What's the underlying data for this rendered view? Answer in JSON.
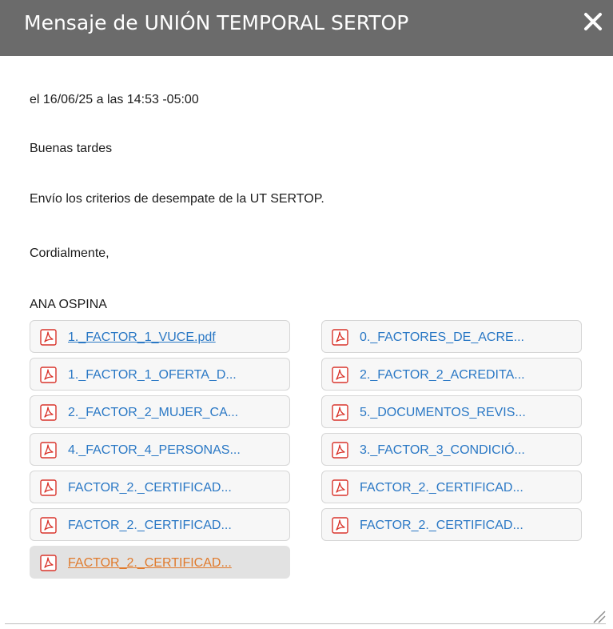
{
  "dialog": {
    "title": "Mensaje de UNIÓN TEMPORAL SERTOP",
    "close_icon": "close-icon",
    "header_color": "#6b6b6b"
  },
  "message": {
    "date_line": "el 16/06/25 a las 14:53 -05:00",
    "greeting": "Buenas tardes",
    "body": "Envío los criterios de desempate de la UT SERTOP.",
    "closing": "Cordialmente,",
    "signature": "ANA OSPINA"
  },
  "attachments": [
    {
      "name": "1._FACTOR_1_VUCE.pdf",
      "icon": "pdf-icon"
    },
    {
      "name": "0._FACTORES_DE_ACRE...",
      "icon": "pdf-icon"
    },
    {
      "name": "1._FACTOR_1_OFERTA_D...",
      "icon": "pdf-icon"
    },
    {
      "name": "2._FACTOR_2_ACREDITA...",
      "icon": "pdf-icon"
    },
    {
      "name": "2._FACTOR_2_MUJER_CA...",
      "icon": "pdf-icon"
    },
    {
      "name": "5._DOCUMENTOS_REVIS...",
      "icon": "pdf-icon"
    },
    {
      "name": "4._FACTOR_4_PERSONAS...",
      "icon": "pdf-icon"
    },
    {
      "name": "3._FACTOR_3_CONDICIÓ...",
      "icon": "pdf-icon"
    },
    {
      "name": "FACTOR_2._CERTIFICAD...",
      "icon": "pdf-icon"
    },
    {
      "name": "FACTOR_2._CERTIFICAD...",
      "icon": "pdf-icon"
    },
    {
      "name": "FACTOR_2._CERTIFICAD...",
      "icon": "pdf-icon"
    },
    {
      "name": "FACTOR_2._CERTIFICAD...",
      "icon": "pdf-icon"
    },
    {
      "name": "FACTOR_2._CERTIFICAD...",
      "icon": "pdf-icon"
    }
  ],
  "colors": {
    "link": "#2a78c5",
    "hover_link": "#e07a2c",
    "pdf_red": "#d9342b"
  }
}
